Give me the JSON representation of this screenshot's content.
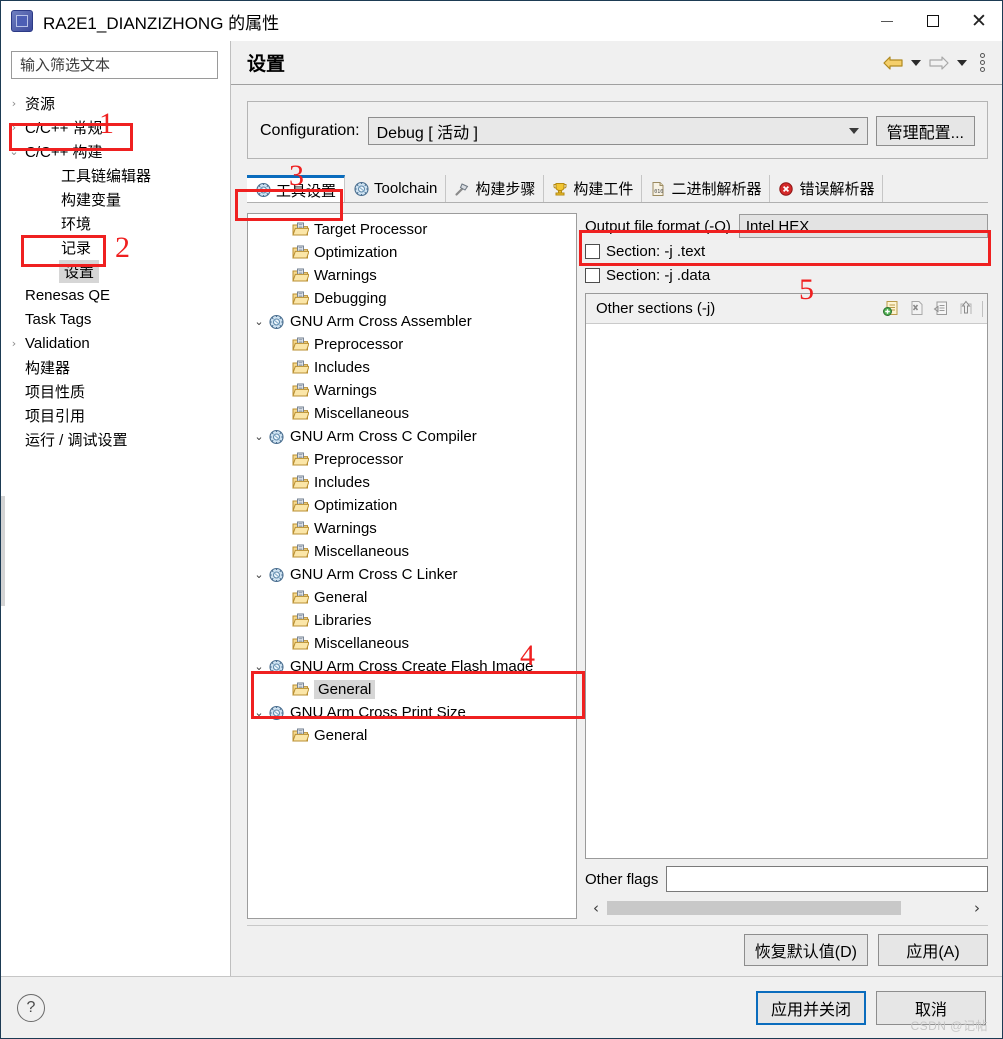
{
  "window": {
    "title": "RA2E1_DIANZIZHONG 的属性",
    "minimize_label": "",
    "maximize_label": "",
    "close_label": "✕"
  },
  "sidebar": {
    "filter_placeholder": "输入筛选文本",
    "filter_value": "",
    "items": [
      {
        "label": "资源",
        "arrow": "›",
        "level": 1,
        "selected": false
      },
      {
        "label": "C/C++ 常规",
        "arrow": "›",
        "level": 1,
        "selected": false
      },
      {
        "label": "C/C++ 构建",
        "arrow": "⌄",
        "level": 1,
        "selected": false
      },
      {
        "label": "工具链编辑器",
        "arrow": "",
        "level": 2,
        "selected": false
      },
      {
        "label": "构建变量",
        "arrow": "",
        "level": 2,
        "selected": false
      },
      {
        "label": "环境",
        "arrow": "",
        "level": 2,
        "selected": false
      },
      {
        "label": "记录",
        "arrow": "",
        "level": 2,
        "selected": false
      },
      {
        "label": "设置",
        "arrow": "",
        "level": 2,
        "selected": true
      },
      {
        "label": "Renesas QE",
        "arrow": "",
        "level": 1,
        "selected": false
      },
      {
        "label": "Task Tags",
        "arrow": "",
        "level": 1,
        "selected": false
      },
      {
        "label": "Validation",
        "arrow": "›",
        "level": 1,
        "selected": false
      },
      {
        "label": "构建器",
        "arrow": "",
        "level": 1,
        "selected": false
      },
      {
        "label": "项目性质",
        "arrow": "",
        "level": 1,
        "selected": false
      },
      {
        "label": "项目引用",
        "arrow": "",
        "level": 1,
        "selected": false
      },
      {
        "label": "运行 / 调试设置",
        "arrow": "",
        "level": 1,
        "selected": false
      }
    ]
  },
  "page": {
    "title": "设置",
    "config_label": "Configuration:",
    "config_value": "Debug [ 活动 ]",
    "manage_button": "管理配置..."
  },
  "tabs": [
    {
      "label": "工具设置",
      "icon": "gear-blue-icon",
      "active": true
    },
    {
      "label": "Toolchain",
      "icon": "gear-blue-icon",
      "active": false
    },
    {
      "label": "构建步骤",
      "icon": "hammer-icon",
      "active": false
    },
    {
      "label": "构建工件",
      "icon": "trophy-icon",
      "active": false
    },
    {
      "label": "二进制解析器",
      "icon": "binary-file-icon",
      "active": false
    },
    {
      "label": "错误解析器",
      "icon": "error-circle-icon",
      "active": false
    }
  ],
  "tool_tree": [
    {
      "label": "Target Processor",
      "level": 2,
      "expander": "",
      "icon": "folder-page-icon",
      "selected": false
    },
    {
      "label": "Optimization",
      "level": 2,
      "expander": "",
      "icon": "folder-page-icon",
      "selected": false
    },
    {
      "label": "Warnings",
      "level": 2,
      "expander": "",
      "icon": "folder-page-icon",
      "selected": false
    },
    {
      "label": "Debugging",
      "level": 2,
      "expander": "",
      "icon": "folder-page-icon",
      "selected": false
    },
    {
      "label": "GNU Arm Cross Assembler",
      "level": 1,
      "expander": "⌄",
      "icon": "gear-blue-icon",
      "selected": false
    },
    {
      "label": "Preprocessor",
      "level": 2,
      "expander": "",
      "icon": "folder-page-icon",
      "selected": false
    },
    {
      "label": "Includes",
      "level": 2,
      "expander": "",
      "icon": "folder-page-icon",
      "selected": false
    },
    {
      "label": "Warnings",
      "level": 2,
      "expander": "",
      "icon": "folder-page-icon",
      "selected": false
    },
    {
      "label": "Miscellaneous",
      "level": 2,
      "expander": "",
      "icon": "folder-page-icon",
      "selected": false
    },
    {
      "label": "GNU Arm Cross C Compiler",
      "level": 1,
      "expander": "⌄",
      "icon": "gear-blue-icon",
      "selected": false
    },
    {
      "label": "Preprocessor",
      "level": 2,
      "expander": "",
      "icon": "folder-page-icon",
      "selected": false
    },
    {
      "label": "Includes",
      "level": 2,
      "expander": "",
      "icon": "folder-page-icon",
      "selected": false
    },
    {
      "label": "Optimization",
      "level": 2,
      "expander": "",
      "icon": "folder-page-icon",
      "selected": false
    },
    {
      "label": "Warnings",
      "level": 2,
      "expander": "",
      "icon": "folder-page-icon",
      "selected": false
    },
    {
      "label": "Miscellaneous",
      "level": 2,
      "expander": "",
      "icon": "folder-page-icon",
      "selected": false
    },
    {
      "label": "GNU Arm Cross C Linker",
      "level": 1,
      "expander": "⌄",
      "icon": "gear-blue-icon",
      "selected": false
    },
    {
      "label": "General",
      "level": 2,
      "expander": "",
      "icon": "folder-page-icon",
      "selected": false
    },
    {
      "label": "Libraries",
      "level": 2,
      "expander": "",
      "icon": "folder-page-icon",
      "selected": false
    },
    {
      "label": "Miscellaneous",
      "level": 2,
      "expander": "",
      "icon": "folder-page-icon",
      "selected": false
    },
    {
      "label": "GNU Arm Cross Create Flash Image",
      "level": 1,
      "expander": "⌄",
      "icon": "gear-blue-icon",
      "selected": false
    },
    {
      "label": "General",
      "level": 2,
      "expander": "",
      "icon": "folder-page-icon",
      "selected": true
    },
    {
      "label": "GNU Arm Cross Print Size",
      "level": 1,
      "expander": "⌄",
      "icon": "gear-blue-icon",
      "selected": false
    },
    {
      "label": "General",
      "level": 2,
      "expander": "",
      "icon": "folder-page-icon",
      "selected": false
    }
  ],
  "options": {
    "output_format_label": "Output file format (-O)",
    "output_format_value": "Intel HEX",
    "checkbox_text": "Section: -j .text",
    "checkbox_text_checked": false,
    "checkbox_data": "Section: -j .data",
    "checkbox_data_checked": false,
    "other_sections_label": "Other sections (-j)",
    "other_sections_items": [],
    "toolbar_icons": [
      "add-icon",
      "delete-icon",
      "edit-icon",
      "move-up-icon"
    ],
    "other_flags_label": "Other flags",
    "other_flags_value": ""
  },
  "content_buttons": {
    "restore_defaults": "恢复默认值(D)",
    "apply": "应用(A)"
  },
  "footer": {
    "help_glyph": "?",
    "apply_and_close": "应用并关闭",
    "cancel": "取消",
    "watermark": "CSDN @记帖"
  },
  "annotations": [
    {
      "number": "1"
    },
    {
      "number": "2"
    },
    {
      "number": "3"
    },
    {
      "number": "4"
    },
    {
      "number": "5"
    }
  ],
  "colors": {
    "accent": "#0a6cbd",
    "annotation_red": "#ef2020",
    "window_bg": "#f0f0f0"
  }
}
